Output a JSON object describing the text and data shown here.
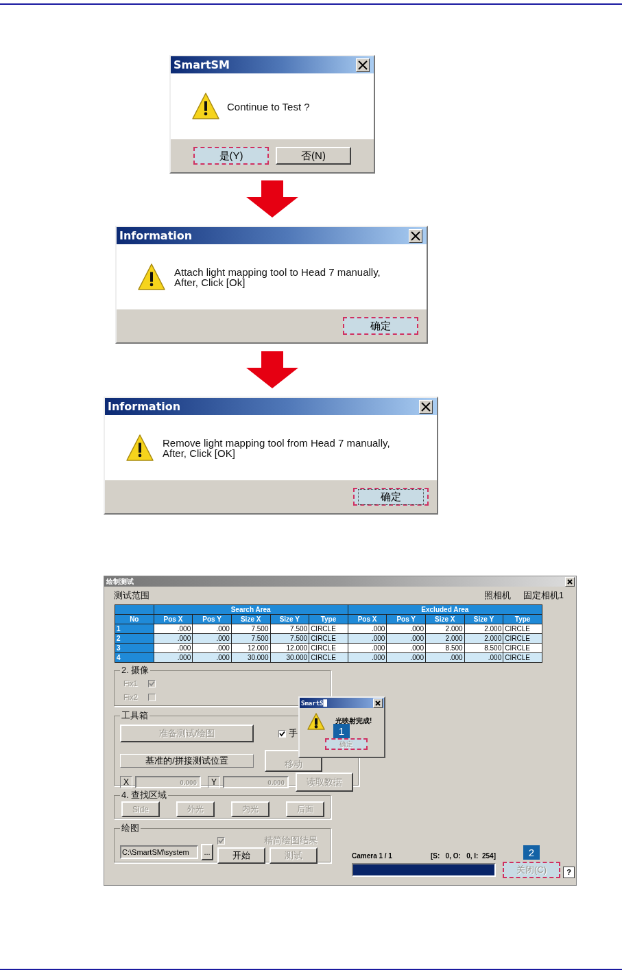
{
  "dialogs": [
    {
      "title": "SmartSM",
      "message": "Continue to Test ?",
      "buttons": [
        {
          "label": "是(Y)",
          "highlighted": true,
          "focused": false
        },
        {
          "label": "否(N)",
          "highlighted": false,
          "focused": false
        }
      ]
    },
    {
      "title": "Information",
      "message": "Attach light mapping tool to Head 7 manually,\nAfter, Click [Ok]",
      "buttons": [
        {
          "label": "确定",
          "highlighted": true,
          "focused": false
        }
      ]
    },
    {
      "title": "Information",
      "message": "Remove light mapping tool from Head 7 manually,\nAfter, Click [OK]",
      "buttons": [
        {
          "label": "确定",
          "highlighted": true,
          "focused": true
        }
      ]
    }
  ],
  "main_window": {
    "title": "绘制测试",
    "range_label": "测试范围",
    "camera_label": "照相机",
    "camera_value": "固定相机1",
    "table": {
      "groups": [
        "Search Area",
        "Excluded Area"
      ],
      "columns": [
        "No",
        "Pos X",
        "Pos Y",
        "Size X",
        "Size Y",
        "Type",
        "Pos X",
        "Pos Y",
        "Size X",
        "Size Y",
        "Type"
      ],
      "rows": [
        [
          "1",
          ".000",
          ".000",
          "7.500",
          "7.500",
          "CIRCLE",
          ".000",
          ".000",
          "2.000",
          "2.000",
          "CIRCLE"
        ],
        [
          "2",
          ".000",
          ".000",
          "7.500",
          "7.500",
          "CIRCLE",
          ".000",
          ".000",
          "2.000",
          "2.000",
          "CIRCLE"
        ],
        [
          "3",
          ".000",
          ".000",
          "12.000",
          "12.000",
          "CIRCLE",
          ".000",
          ".000",
          "8.500",
          "8.500",
          "CIRCLE"
        ],
        [
          "4",
          ".000",
          ".000",
          "30.000",
          "30.000",
          "CIRCLE",
          ".000",
          ".000",
          ".000",
          ".000",
          "CIRCLE"
        ]
      ]
    },
    "camera_group": {
      "title": "2. 摄像",
      "checks": [
        {
          "label": "Fix1",
          "checked": true,
          "disabled": true
        },
        {
          "label": "Fix2",
          "checked": false,
          "disabled": true
        }
      ]
    },
    "toolbox": {
      "title": "工具箱",
      "prepare_button": {
        "label": "准备测试/绘图",
        "disabled": true
      },
      "manual_check": {
        "label": "手",
        "checked": true,
        "disabled": false
      },
      "reference_label": "基准的/拼接测试位置",
      "move_button": {
        "label": "移动",
        "disabled": true
      },
      "x_label": "X",
      "x_field": {
        "value": "0.000",
        "disabled": true
      },
      "y_label": "Y",
      "y_field": {
        "value": "0.000",
        "disabled": true
      },
      "read_button": {
        "label": "读取数据",
        "disabled": true
      }
    },
    "search_group": {
      "title": "4. 查找区域",
      "buttons": [
        {
          "label": "Side",
          "disabled": true
        },
        {
          "label": "外光",
          "disabled": true
        },
        {
          "label": "内光",
          "disabled": true
        },
        {
          "label": "后面",
          "disabled": true
        }
      ]
    },
    "drawing_group": {
      "title": "绘图",
      "path": "C:\\SmartSM\\system",
      "browse_button": {
        "label": "...",
        "disabled": false
      },
      "simplify_check": {
        "label": "精简绘图结果",
        "checked": true,
        "disabled": true
      },
      "start_button": {
        "label": "开始",
        "disabled": false
      },
      "test_button": {
        "label": "测试",
        "disabled": true
      }
    },
    "status": {
      "camera": "Camera 1 / 1",
      "counts": "[S:   0, O:   0, I:  254]",
      "progress": {
        "level": 1
      }
    },
    "close_button": {
      "label": "关闭(C)",
      "highlighted": true,
      "disabled": true,
      "callout": "2"
    },
    "help_button": {
      "label": "?"
    },
    "popup": {
      "title": "SmartS█",
      "message": "光映射完成!",
      "button": {
        "label": "确定",
        "highlighted": true,
        "disabled": true
      },
      "callout": "1"
    }
  }
}
